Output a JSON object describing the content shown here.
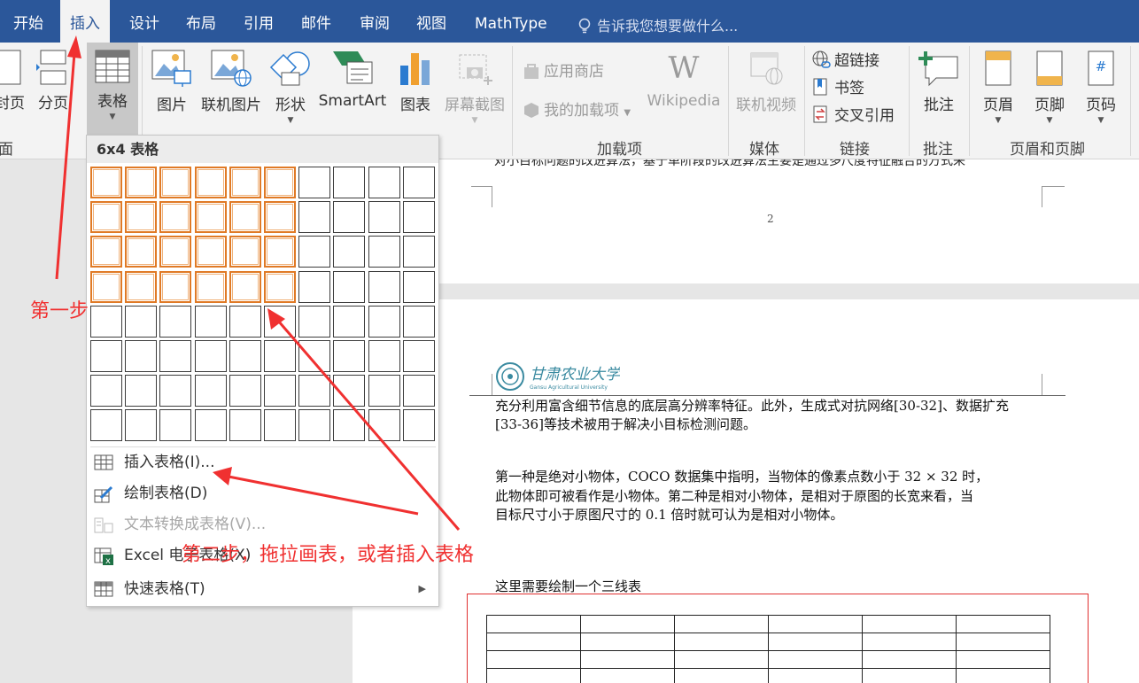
{
  "tabs": [
    "开始",
    "插入",
    "设计",
    "布局",
    "引用",
    "邮件",
    "审阅",
    "视图",
    "MathType"
  ],
  "active_tab": "插入",
  "tell_me": "告诉我您想要做什么...",
  "ribbon": {
    "pages": {
      "cover_fragment": "封页",
      "page_break": "分页",
      "group_fragment": "面"
    },
    "table_button": "表格",
    "illustrations": {
      "picture": "图片",
      "online_picture": "联机图片",
      "shapes": "形状",
      "smartart": "SmartArt",
      "chart": "图表",
      "screenshot": "屏幕截图"
    },
    "addins": {
      "store": "应用商店",
      "my_addins": "我的加载项",
      "wikipedia": "Wikipedia",
      "group_label": "加载项"
    },
    "media": {
      "online_video": "联机视频",
      "group_label": "媒体"
    },
    "links": {
      "hyperlink": "超链接",
      "bookmark": "书签",
      "cross_reference": "交叉引用",
      "group_label": "链接"
    },
    "comments": {
      "comment": "批注",
      "group_label": "批注"
    },
    "header_footer": {
      "header": "页眉",
      "footer": "页脚",
      "page_number": "页码",
      "group_label": "页眉和页脚"
    }
  },
  "dropdown": {
    "title": "6x4 表格",
    "grid": {
      "columns": 10,
      "rows": 8,
      "selected_columns": 6,
      "selected_rows": 4
    },
    "items": [
      {
        "label": "插入表格(I)...",
        "disabled": false
      },
      {
        "label": "绘制表格(D)",
        "disabled": false
      },
      {
        "label": "文本转换成表格(V)...",
        "disabled": true
      },
      {
        "label": "Excel 电子表格(X)",
        "disabled": false
      },
      {
        "label": "快速表格(T)",
        "disabled": false
      }
    ]
  },
  "document": {
    "page1_cut_text": "对小目标问题的改进算法，基于单阶段的改进算法主要是通过多尺度特征融合的方式来",
    "page_number": "2",
    "logo_text": "甘肃农业大学",
    "logo_subtext": "Gansu Agricultural University",
    "para1_line1": "充分利用富含细节信息的底层高分辨率特征。此外，生成式对抗网络[30-32]、数据扩充",
    "para1_line2": "[33-36]等技术被用于解决小目标检测问题。",
    "para2_line1": "第一种是绝对小物体，COCO 数据集中指明，当物体的像素点数小于 32 × 32 时，",
    "para2_line2": "此物体即可被看作是小物体。第二种是相对小物体，是相对于原图的长宽来看，当",
    "para2_line3": "目标尺寸小于原图尺寸的 0.1 倍时就可认为是相对小物体。",
    "table_note": "这里需要绘制一个三线表",
    "table": {
      "rows": 4,
      "columns": 6
    }
  },
  "annotations": {
    "step1": "第一步",
    "step2": "第二步，拖拉画表，或者插入表格"
  },
  "colors": {
    "tab_bar": "#2b579a",
    "selection": "#e07a26",
    "annotation": "#f03030"
  }
}
